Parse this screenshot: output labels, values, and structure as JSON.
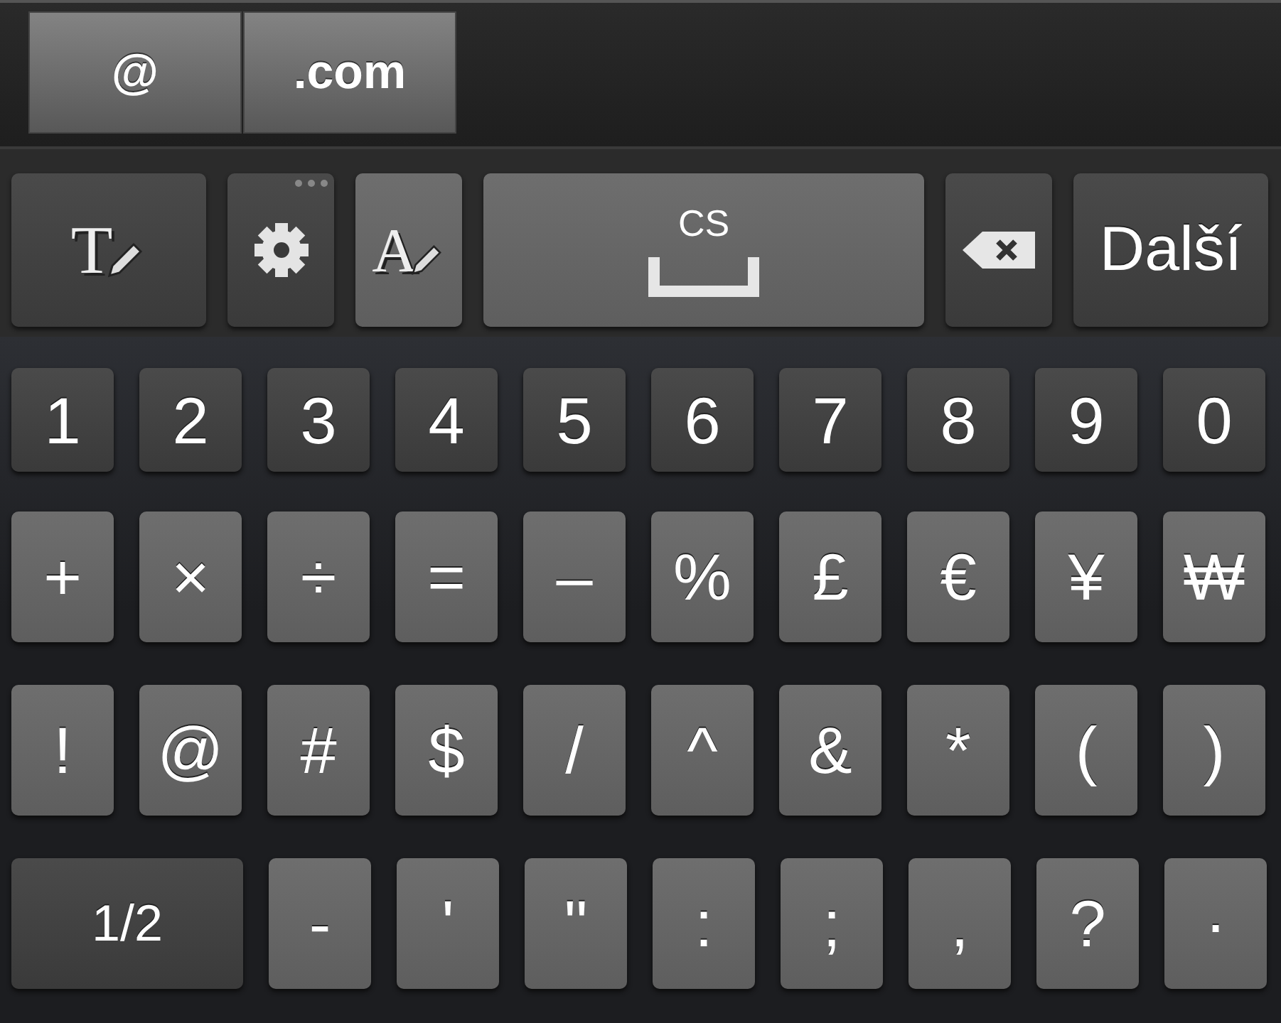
{
  "suggestions": [
    {
      "label": "@"
    },
    {
      "label": ".com"
    }
  ],
  "toolbar": [
    {
      "kind": "text-style",
      "glyph": "T"
    },
    {
      "kind": "settings"
    },
    {
      "kind": "font",
      "glyph": "A"
    },
    {
      "kind": "space",
      "label": "CS"
    },
    {
      "kind": "backspace"
    },
    {
      "kind": "action",
      "label": "Další"
    }
  ],
  "rows": [
    {
      "keys": [
        {
          "label": "1",
          "kind": "number"
        },
        {
          "label": "2",
          "kind": "number"
        },
        {
          "label": "3",
          "kind": "number"
        },
        {
          "label": "4",
          "kind": "number"
        },
        {
          "label": "5",
          "kind": "number"
        },
        {
          "label": "6",
          "kind": "number"
        },
        {
          "label": "7",
          "kind": "number"
        },
        {
          "label": "8",
          "kind": "number"
        },
        {
          "label": "9",
          "kind": "number"
        },
        {
          "label": "0",
          "kind": "number"
        }
      ]
    },
    {
      "keys": [
        {
          "label": "+",
          "kind": "symbol"
        },
        {
          "label": "×",
          "kind": "symbol"
        },
        {
          "label": "÷",
          "kind": "symbol"
        },
        {
          "label": "=",
          "kind": "symbol"
        },
        {
          "label": "–",
          "kind": "symbol"
        },
        {
          "label": "%",
          "kind": "symbol"
        },
        {
          "label": "£",
          "kind": "symbol"
        },
        {
          "label": "€",
          "kind": "symbol"
        },
        {
          "label": "¥",
          "kind": "symbol"
        },
        {
          "label": "₩",
          "kind": "symbol"
        }
      ]
    },
    {
      "keys": [
        {
          "label": "!",
          "kind": "symbol"
        },
        {
          "label": "@",
          "kind": "symbol"
        },
        {
          "label": "#",
          "kind": "symbol"
        },
        {
          "label": "$",
          "kind": "symbol"
        },
        {
          "label": "/",
          "kind": "symbol"
        },
        {
          "label": "^",
          "kind": "symbol"
        },
        {
          "label": "&",
          "kind": "symbol"
        },
        {
          "label": "*",
          "kind": "symbol"
        },
        {
          "label": "(",
          "kind": "symbol"
        },
        {
          "label": ")",
          "kind": "symbol"
        }
      ]
    },
    {
      "keys": [
        {
          "label": "1/2",
          "kind": "mode"
        },
        {
          "label": "-",
          "kind": "symbol"
        },
        {
          "label": "'",
          "kind": "symbol"
        },
        {
          "label": "\"",
          "kind": "symbol"
        },
        {
          "label": ":",
          "kind": "symbol"
        },
        {
          "label": ";",
          "kind": "symbol"
        },
        {
          "label": ",",
          "kind": "symbol"
        },
        {
          "label": "?",
          "kind": "symbol"
        },
        {
          "label": "·",
          "kind": "symbol"
        }
      ]
    }
  ]
}
